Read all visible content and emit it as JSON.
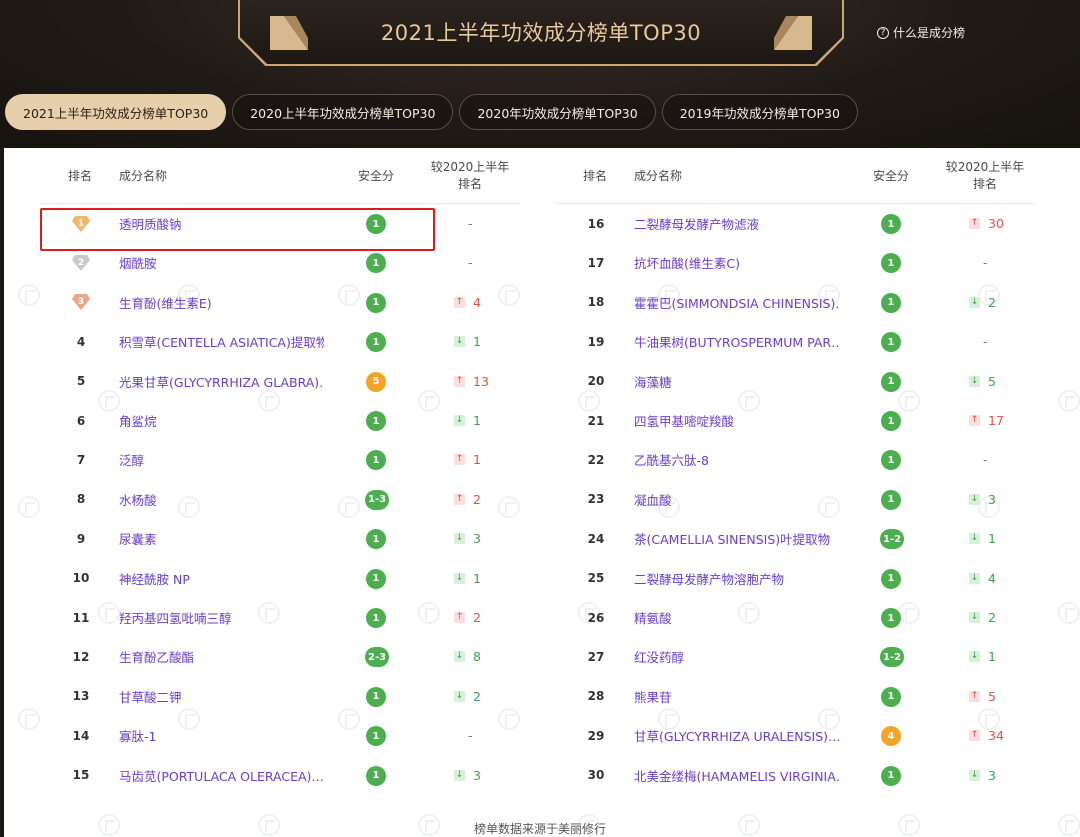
{
  "header": {
    "title": "2021上半年功效成分榜单TOP30",
    "help_label": "什么是成分榜",
    "help_icon": "question-circle-icon"
  },
  "tabs": [
    {
      "label": "2021上半年功效成分榜单TOP30",
      "active": true
    },
    {
      "label": "2020上半年功效成分榜单TOP30",
      "active": false
    },
    {
      "label": "2020年功效成分榜单TOP30",
      "active": false
    },
    {
      "label": "2019年功效成分榜单TOP30",
      "active": false
    }
  ],
  "table_headers": {
    "rank": "排名",
    "name": "成分名称",
    "safety": "安全分",
    "change_line1": "较2020上半年",
    "change_line2": "排名"
  },
  "colors": {
    "name": "#6a3ec8",
    "score_green": "#4cae4f",
    "score_orange": "#f4a324",
    "up": "#e8504d",
    "down": "#3aa54a",
    "highlight": "#e01b1b"
  },
  "rows_left": [
    {
      "rank": "1",
      "medal": "gold",
      "name": "透明质酸钠",
      "score": "1",
      "score_color": "green",
      "dir": "none",
      "change": "-"
    },
    {
      "rank": "2",
      "medal": "silver",
      "name": "烟酰胺",
      "score": "1",
      "score_color": "green",
      "dir": "none",
      "change": "-"
    },
    {
      "rank": "3",
      "medal": "bronze",
      "name": "生育酚(维生素E)",
      "score": "1",
      "score_color": "green",
      "dir": "up",
      "change": "4"
    },
    {
      "rank": "4",
      "name": "积雪草(CENTELLA ASIATICA)提取物",
      "score": "1",
      "score_color": "green",
      "dir": "down",
      "change": "1"
    },
    {
      "rank": "5",
      "name": "光果甘草(GLYCYRRHIZA GLABRA)…",
      "score": "5",
      "score_color": "orange",
      "dir": "up",
      "change": "13"
    },
    {
      "rank": "6",
      "name": "角鲨烷",
      "score": "1",
      "score_color": "green",
      "dir": "down",
      "change": "1"
    },
    {
      "rank": "7",
      "name": "泛醇",
      "score": "1",
      "score_color": "green",
      "dir": "up",
      "change": "1"
    },
    {
      "rank": "8",
      "name": "水杨酸",
      "score": "1-3",
      "score_color": "green",
      "dir": "up",
      "change": "2"
    },
    {
      "rank": "9",
      "name": "尿囊素",
      "score": "1",
      "score_color": "green",
      "dir": "down",
      "change": "3"
    },
    {
      "rank": "10",
      "name": "神经酰胺 NP",
      "score": "1",
      "score_color": "green",
      "dir": "down",
      "change": "1"
    },
    {
      "rank": "11",
      "name": "羟丙基四氢吡喃三醇",
      "score": "1",
      "score_color": "green",
      "dir": "up",
      "change": "2"
    },
    {
      "rank": "12",
      "name": "生育酚乙酸酯",
      "score": "2-3",
      "score_color": "green",
      "dir": "down",
      "change": "8"
    },
    {
      "rank": "13",
      "name": "甘草酸二钾",
      "score": "1",
      "score_color": "green",
      "dir": "down",
      "change": "2"
    },
    {
      "rank": "14",
      "name": "寡肽-1",
      "score": "1",
      "score_color": "green",
      "dir": "none",
      "change": "-"
    },
    {
      "rank": "15",
      "name": "马齿苋(PORTULACA OLERACEA)…",
      "score": "1",
      "score_color": "green",
      "dir": "down",
      "change": "3"
    }
  ],
  "rows_right": [
    {
      "rank": "16",
      "name": "二裂酵母发酵产物滤液",
      "score": "1",
      "score_color": "green",
      "dir": "up",
      "change": "30"
    },
    {
      "rank": "17",
      "name": "抗坏血酸(维生素C)",
      "score": "1",
      "score_color": "green",
      "dir": "none",
      "change": "-"
    },
    {
      "rank": "18",
      "name": "霍霍巴(SIMMONDSIA CHINENSIS)…",
      "score": "1",
      "score_color": "green",
      "dir": "down",
      "change": "2"
    },
    {
      "rank": "19",
      "name": "牛油果树(BUTYROSPERMUM PAR…",
      "score": "1",
      "score_color": "green",
      "dir": "none",
      "change": "-"
    },
    {
      "rank": "20",
      "name": "海藻糖",
      "score": "1",
      "score_color": "green",
      "dir": "down",
      "change": "5"
    },
    {
      "rank": "21",
      "name": "四氢甲基嘧啶羧酸",
      "score": "1",
      "score_color": "green",
      "dir": "up",
      "change": "17"
    },
    {
      "rank": "22",
      "name": "乙酰基六肽-8",
      "score": "1",
      "score_color": "green",
      "dir": "none",
      "change": "-"
    },
    {
      "rank": "23",
      "name": "凝血酸",
      "score": "1",
      "score_color": "green",
      "dir": "down",
      "change": "3"
    },
    {
      "rank": "24",
      "name": "茶(CAMELLIA SINENSIS)叶提取物",
      "score": "1-2",
      "score_color": "green",
      "dir": "down",
      "change": "1"
    },
    {
      "rank": "25",
      "name": "二裂酵母发酵产物溶胞产物",
      "score": "1",
      "score_color": "green",
      "dir": "down",
      "change": "4"
    },
    {
      "rank": "26",
      "name": "精氨酸",
      "score": "1",
      "score_color": "green",
      "dir": "down",
      "change": "2"
    },
    {
      "rank": "27",
      "name": "红没药醇",
      "score": "1-2",
      "score_color": "green",
      "dir": "down",
      "change": "1"
    },
    {
      "rank": "28",
      "name": "熊果苷",
      "score": "1",
      "score_color": "green",
      "dir": "up",
      "change": "5"
    },
    {
      "rank": "29",
      "name": "甘草(GLYCYRRHIZA URALENSIS)…",
      "score": "4",
      "score_color": "orange",
      "dir": "up",
      "change": "34"
    },
    {
      "rank": "30",
      "name": "北美金缕梅(HAMAMELIS VIRGINIA…",
      "score": "1",
      "score_color": "green",
      "dir": "down",
      "change": "3"
    }
  ],
  "footer_note": "榜单数据来源于美丽修行"
}
